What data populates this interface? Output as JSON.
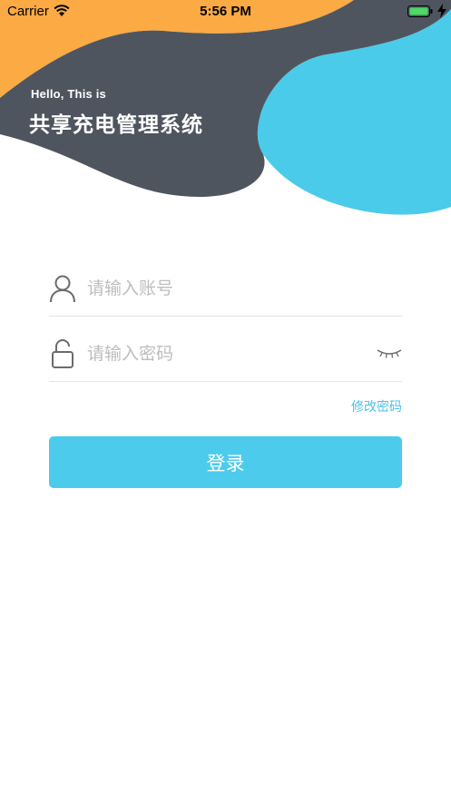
{
  "status_bar": {
    "carrier": "Carrier",
    "time": "5:56 PM"
  },
  "header": {
    "greeting": "Hello, This is",
    "title": "共享充电管理系统"
  },
  "form": {
    "account_placeholder": "请输入账号",
    "password_placeholder": "请输入密码",
    "forgot_password": "修改密码",
    "login_button": "登录"
  },
  "colors": {
    "accent": "#4CCBEC",
    "link": "#4BC0E6",
    "header_dark": "#4F555F",
    "header_orange": "#FBAA44",
    "header_blue": "#4BCBEA"
  },
  "icons": [
    "wifi-icon",
    "battery-icon",
    "charging-icon",
    "user-icon",
    "lock-icon",
    "eye-closed-icon"
  ]
}
